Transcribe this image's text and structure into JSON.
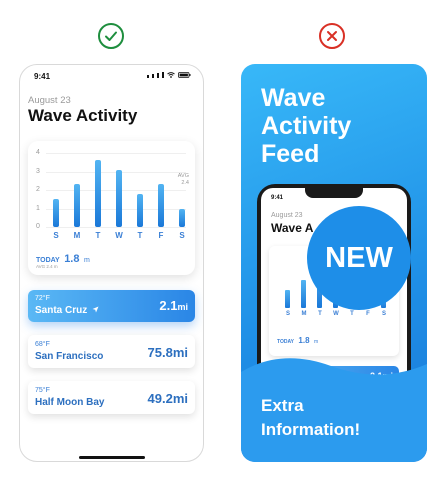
{
  "good_example": {
    "status_time": "9:41",
    "date": "August 23",
    "title": "Wave Activity",
    "chart_data": {
      "type": "bar",
      "categories": [
        "S",
        "M",
        "T",
        "W",
        "T",
        "F",
        "S"
      ],
      "values": [
        1.5,
        2.3,
        3.6,
        3.1,
        1.8,
        2.3,
        1.0
      ],
      "ylim": [
        0,
        4
      ],
      "yticks": [
        "0",
        "1",
        "2",
        "3",
        "4"
      ],
      "avg_label": "AVG",
      "avg_value": "2.4"
    },
    "today": {
      "label": "TODAY",
      "value": "1.8",
      "unit": "m",
      "sub": "AVG 2.4 m"
    },
    "locations": [
      {
        "temp": "72°F",
        "name": "Santa Cruz",
        "distance": "2.1",
        "unit": "mi",
        "active": true
      },
      {
        "temp": "68°F",
        "name": "San Francisco",
        "distance": "75.8mi",
        "active": false
      },
      {
        "temp": "75°F",
        "name": "Half Moon Bay",
        "distance": "49.2mi",
        "active": false
      }
    ]
  },
  "bad_example": {
    "headline": [
      "Wave",
      "Activity",
      "Feed"
    ],
    "badge": "NEW",
    "mini_phone": {
      "status_time": "9:41",
      "date": "August 23",
      "title": "Wave A",
      "today_label": "TODAY",
      "today_value": "1.8",
      "today_unit": "m",
      "distance": "2.1mi"
    },
    "footer": [
      "Extra",
      "Information!"
    ]
  },
  "colors": {
    "good": "#1e8e3e",
    "bad": "#d93025",
    "accent": "#2a86e6"
  }
}
